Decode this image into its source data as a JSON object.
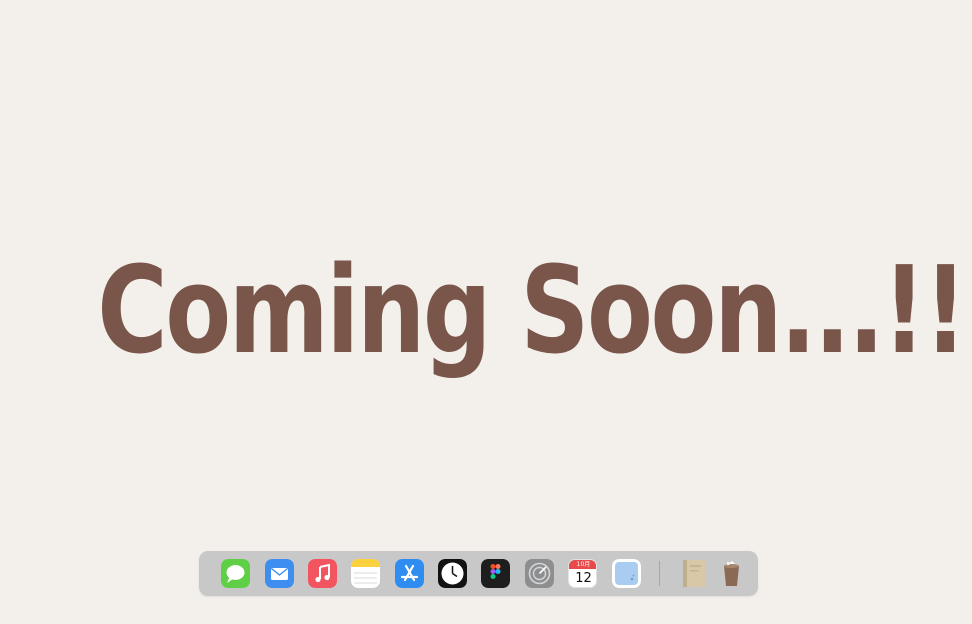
{
  "headline": {
    "text": "Coming Soon...!!"
  },
  "colors": {
    "background": "#f3f0eb",
    "headline": "#7a554a",
    "dock": "#c8c8c9"
  },
  "dock": {
    "apps": [
      {
        "name": "Messages",
        "icon": "messages-icon"
      },
      {
        "name": "Mail",
        "icon": "mail-icon"
      },
      {
        "name": "Music",
        "icon": "music-icon"
      },
      {
        "name": "Notes",
        "icon": "notes-icon"
      },
      {
        "name": "App Store",
        "icon": "app-store-icon"
      },
      {
        "name": "Clock",
        "icon": "clock-icon"
      },
      {
        "name": "Figma",
        "icon": "figma-icon"
      },
      {
        "name": "Radar",
        "icon": "radar-icon"
      },
      {
        "name": "Calendar",
        "icon": "calendar-icon"
      },
      {
        "name": "Preview",
        "icon": "preview-icon"
      }
    ],
    "calendar": {
      "month": "10月",
      "day": "12"
    },
    "extras": [
      {
        "name": "Book",
        "icon": "book-icon"
      },
      {
        "name": "Trash",
        "icon": "trash-icon"
      }
    ]
  }
}
